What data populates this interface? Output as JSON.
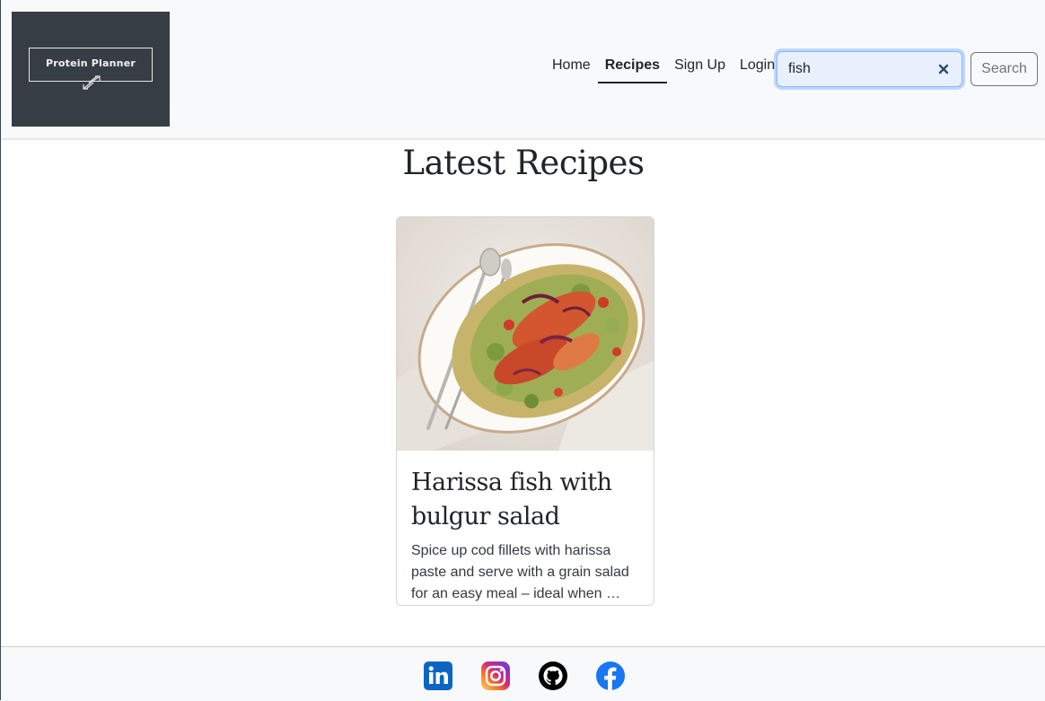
{
  "brand": {
    "logo_text": "Protein Planner",
    "background_color": "#373d44",
    "icon": "expand-arrows-icon"
  },
  "nav": {
    "items": [
      {
        "label": "Home",
        "active": false
      },
      {
        "label": "Recipes",
        "active": true
      },
      {
        "label": "Sign Up",
        "active": false
      },
      {
        "label": "Login",
        "active": false
      }
    ]
  },
  "search": {
    "value": "fish",
    "clear_icon": "close-icon",
    "button_label": "Search",
    "focus_color": "#86b7fe"
  },
  "main": {
    "title": "Latest Recipes",
    "recipes": [
      {
        "title": "Harissa fish with bulgur salad",
        "description": "Spice up cod fillets with harissa paste and serve with a grain salad for an easy meal – ideal when …",
        "image": "harissa-fish-bulgur-salad-photo"
      }
    ]
  },
  "footer": {
    "social_icons": [
      "linkedin-icon",
      "instagram-icon",
      "github-icon",
      "facebook-icon"
    ],
    "colors": {
      "linkedin": "#0a66c2",
      "github": "#000000",
      "facebook": "#1877f2"
    }
  }
}
